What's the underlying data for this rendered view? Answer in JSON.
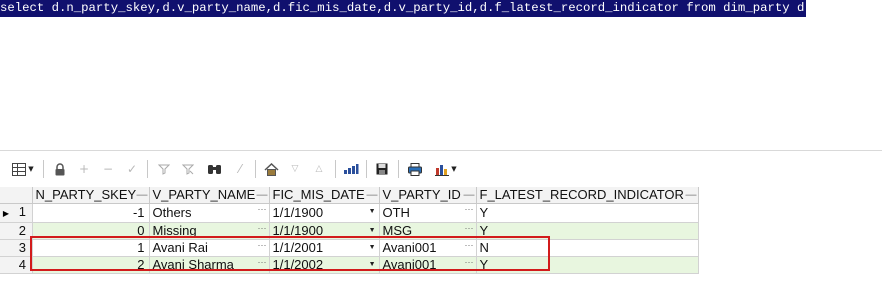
{
  "editor": {
    "sql": "select d.n_party_skey,d.v_party_name,d.fic_mis_date,d.v_party_id,d.f_latest_record_indicator from dim_party d"
  },
  "toolbar": {
    "icons": [
      "grid-menu-icon",
      "lock-icon",
      "add-row-icon",
      "delete-row-icon",
      "post-checkmark-icon",
      "filter-icon",
      "clear-filter-icon",
      "find-binoculars-icon",
      "clear-icon",
      "home-icon",
      "prior-icon",
      "next-icon",
      "refresh-icon",
      "save-icon",
      "print-icon",
      "chart-icon"
    ]
  },
  "grid": {
    "columns": [
      "N_PARTY_SKEY",
      "V_PARTY_NAME",
      "FIC_MIS_DATE",
      "V_PARTY_ID",
      "F_LATEST_RECORD_INDICATOR"
    ],
    "rows": [
      {
        "num": "1",
        "skey": "-1",
        "name": "Others",
        "date": "1/1/1900",
        "id": "OTH",
        "flag": "Y",
        "current": true
      },
      {
        "num": "2",
        "skey": "0",
        "name": "Missing",
        "date": "1/1/1900",
        "id": "MSG",
        "flag": "Y",
        "current": false
      },
      {
        "num": "3",
        "skey": "1",
        "name": "Avani Rai",
        "date": "1/1/2001",
        "id": "Avani001",
        "flag": "N",
        "current": false
      },
      {
        "num": "4",
        "skey": "2",
        "name": "Avani Sharma",
        "date": "1/1/2002",
        "id": "Avani001",
        "flag": "Y",
        "current": false
      }
    ]
  },
  "colors": {
    "sql_highlight": "#10106e",
    "even_row": "#e8f6df",
    "highlight_border": "#d21b1b"
  }
}
